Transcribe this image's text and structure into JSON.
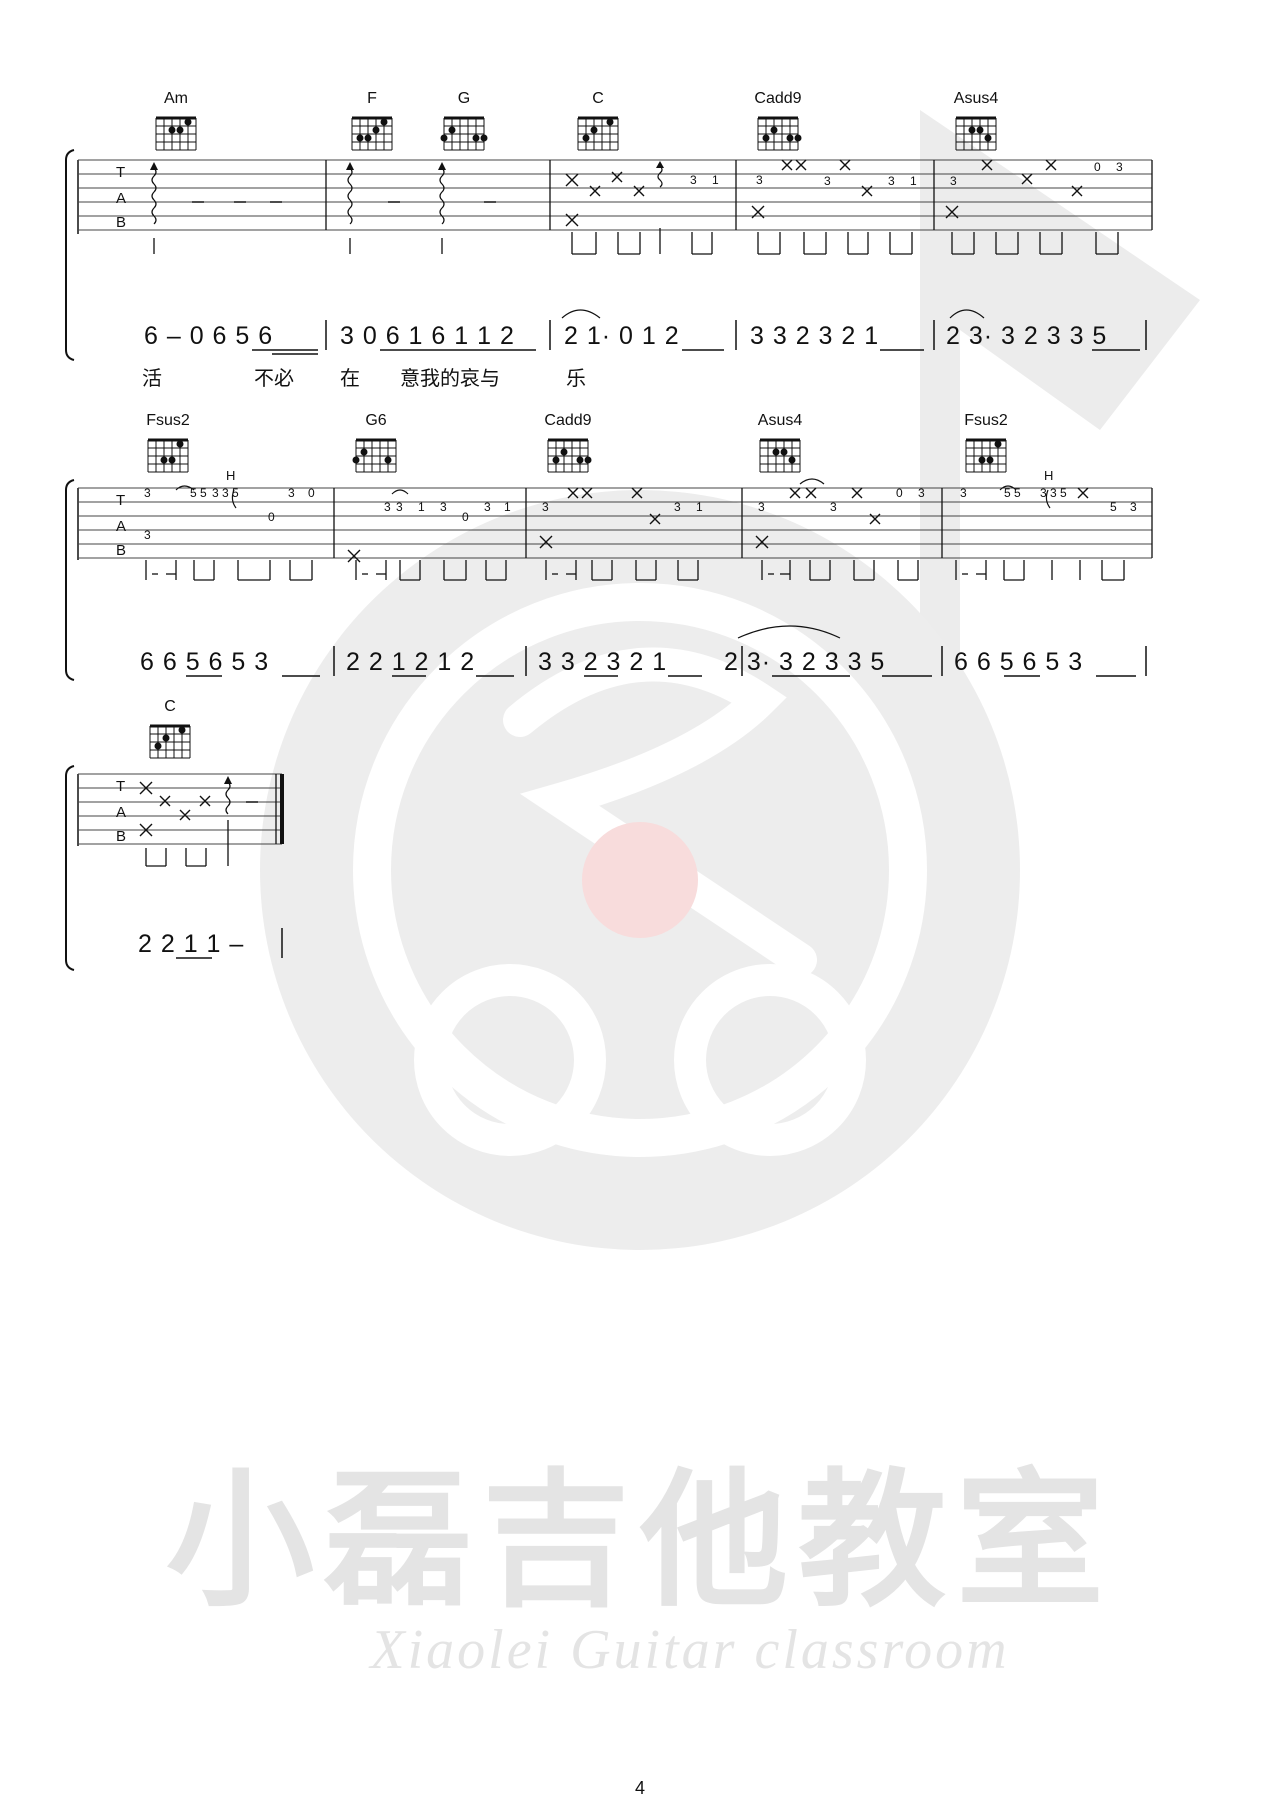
{
  "watermark": {
    "title": "小磊吉他教室",
    "subtitle": "Xiaolei Guitar classroom"
  },
  "tab_clef": [
    "T",
    "A",
    "B"
  ],
  "systems": [
    {
      "chords": [
        "Am",
        "F",
        "G",
        "C",
        "Cadd9",
        "Asus4"
      ],
      "jianpu": [
        "6 – 0 6 5 6",
        "3 0 6 1 6 1 1 2",
        "2 1· 0 1 2",
        "3 3 2 3 2 1",
        "2 3· 3 2 3 3 5"
      ],
      "lyrics": [
        "活",
        "不必",
        "在",
        "意我的哀与",
        "乐"
      ],
      "fret_numbers": [
        "3",
        "1",
        "3",
        "3",
        "3",
        "1",
        "3",
        "0",
        "3"
      ]
    },
    {
      "chords": [
        "Fsus2",
        "G6",
        "Cadd9",
        "Asus4",
        "Fsus2"
      ],
      "jianpu": [
        "6 6 5 6 5 3",
        "2 2 1 2 1 2",
        "3 3 2 3 2 1",
        "2 3· 3 2 3 3 5",
        "6 6 5 6 5 3"
      ],
      "technique": [
        "H",
        "H"
      ],
      "fret_numbers": [
        "3",
        "5",
        "5",
        "3",
        "3",
        "5",
        "0",
        "3",
        "0",
        "3",
        "3",
        "3",
        "1",
        "3",
        "0",
        "3",
        "1",
        "3",
        "3",
        "1",
        "3",
        "3",
        "0",
        "3",
        "3",
        "5",
        "5",
        "3",
        "3",
        "5",
        "5",
        "3"
      ]
    },
    {
      "chords": [
        "C"
      ],
      "jianpu": [
        "2 2 1 1 –"
      ]
    }
  ],
  "page_number": "4"
}
